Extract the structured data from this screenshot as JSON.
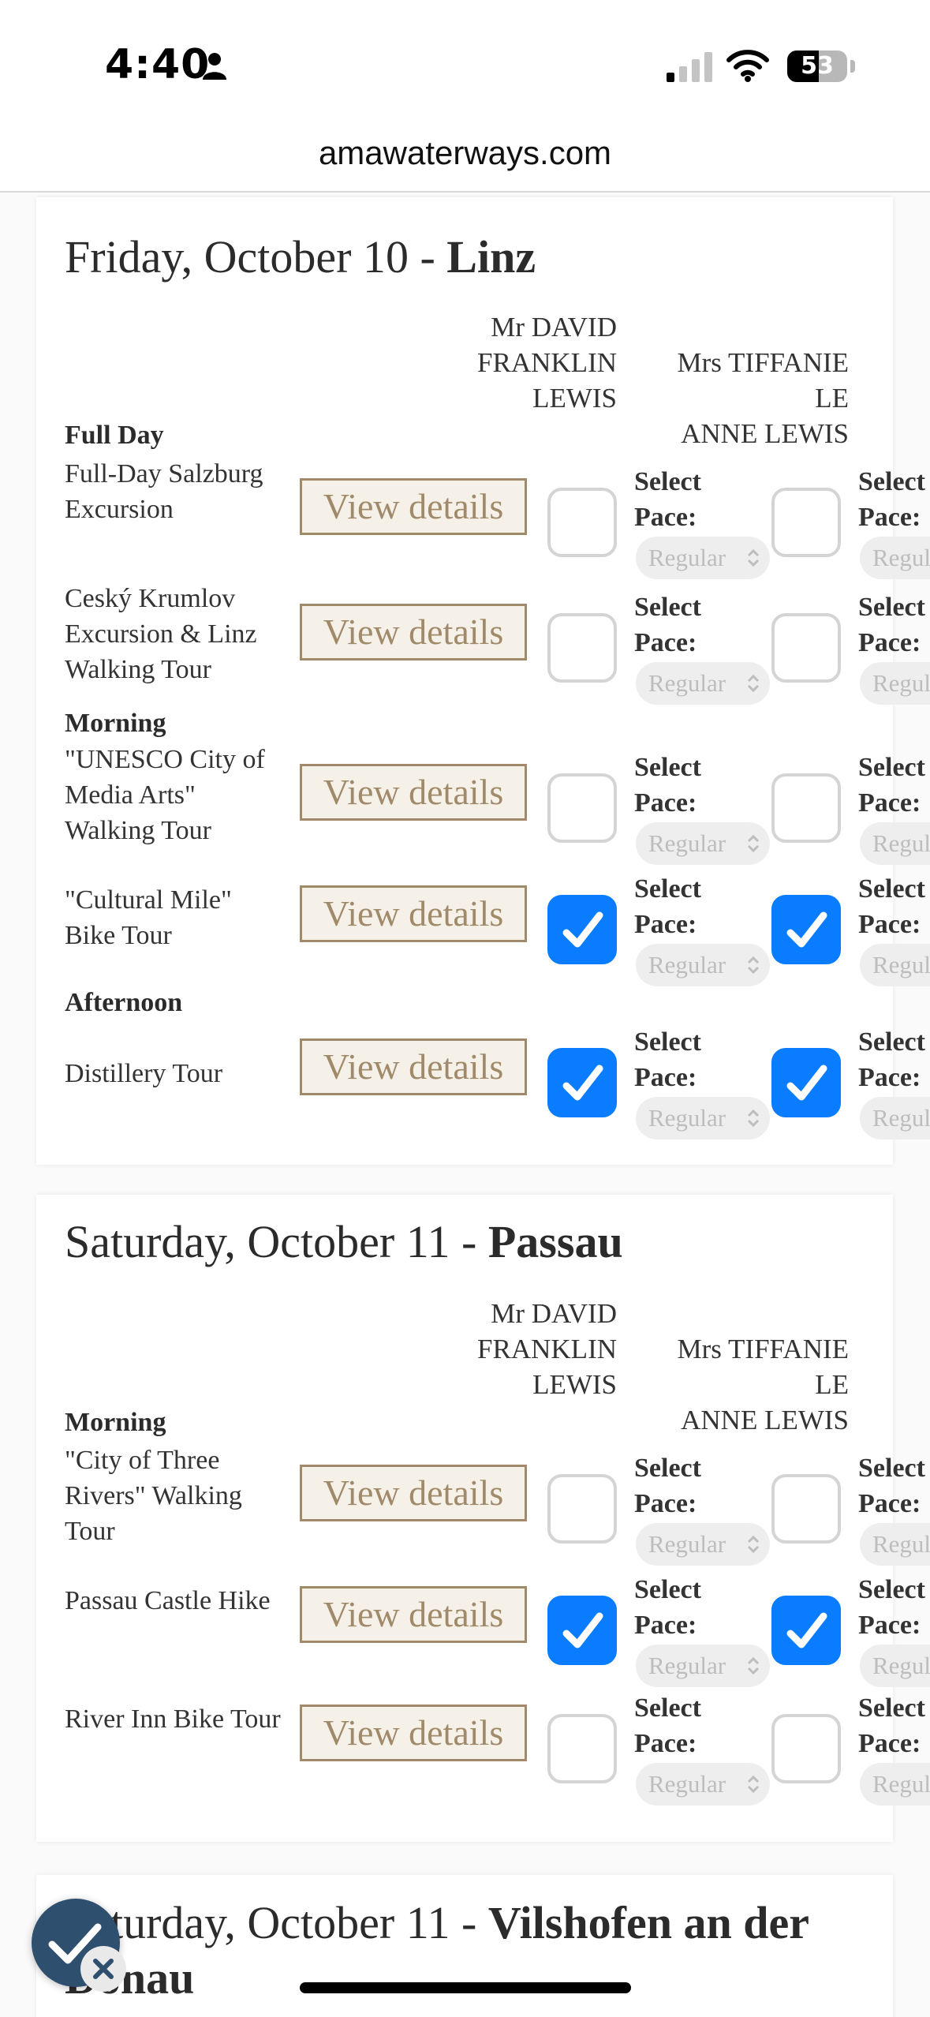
{
  "status_bar": {
    "time": "4:40",
    "battery": "53",
    "battery_level": 0.53
  },
  "url_bar": {
    "domain": "amawaterways.com"
  },
  "common": {
    "view_details": "View details",
    "select": "Select",
    "pace": "Pace:",
    "pace_value": "Regular"
  },
  "days": [
    {
      "date": "Friday, October 10 - ",
      "place": "Linz",
      "guests": [
        "Mr DAVID FRANKLIN LEWIS",
        "Mrs TIFFANIE LE ANNE LEWIS"
      ],
      "guest1_lines": [
        "Mr DAVID",
        "FRANKLIN",
        "LEWIS"
      ],
      "guest2_lines": [
        "Mrs TIFFANIE LE",
        "ANNE LEWIS"
      ],
      "periods": [
        "Full Day",
        "Morning",
        "Afternoon"
      ],
      "tours": [
        {
          "name": "Full-Day Salzburg Excursion",
          "selected": [
            false,
            false
          ]
        },
        {
          "name": "Ceský Krumlov Excursion & Linz Walking Tour",
          "selected": [
            false,
            false
          ]
        },
        {
          "name": "\"UNESCO City of Media Arts\" Walking Tour",
          "selected": [
            false,
            false
          ]
        },
        {
          "name": "\"Cultural Mile\" Bike Tour",
          "selected": [
            true,
            true
          ]
        },
        {
          "name": "Distillery Tour",
          "selected": [
            true,
            true
          ]
        }
      ]
    },
    {
      "date": "Saturday, October 11 - ",
      "place": "Passau",
      "guest1_lines": [
        "Mr DAVID",
        "FRANKLIN",
        "LEWIS"
      ],
      "guest2_lines": [
        "Mrs TIFFANIE LE",
        "ANNE LEWIS"
      ],
      "periods": [
        "Morning"
      ],
      "tours": [
        {
          "name": "\"City of Three Rivers\" Walking Tour",
          "selected": [
            false,
            false
          ]
        },
        {
          "name": "Passau Castle Hike",
          "selected": [
            true,
            true
          ]
        },
        {
          "name": "River Inn Bike Tour",
          "selected": [
            false,
            false
          ]
        }
      ]
    },
    {
      "date": "Saturday, October 11 - ",
      "place": "Vilshofen an der Donau"
    }
  ],
  "colors": {
    "accent": "#0a7cff",
    "button_border": "#a08a6a",
    "button_bg": "#f5f0e8"
  },
  "icons": [
    "person-icon",
    "signal-icon",
    "wifi-icon",
    "check-icon",
    "chevron-updown-icon"
  ]
}
